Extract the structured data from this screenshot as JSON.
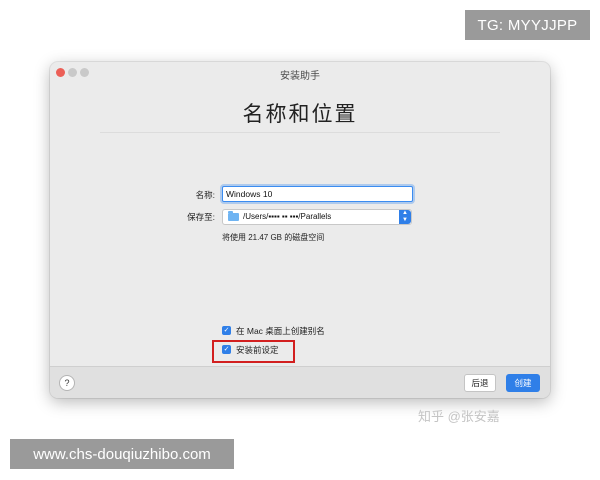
{
  "overlay": {
    "tg_badge": "TG: MYYJJPP",
    "site_banner": "www.chs-douqiuzhibo.com",
    "watermark": "知乎 @张安嘉"
  },
  "window": {
    "title": "安装助手",
    "heading": "名称和位置",
    "name_label": "名称:",
    "name_value": "Windows 10",
    "save_label": "保存至:",
    "save_path": "/Users/▪▪▪▪ ▪▪ ▪▪▪/Parallels",
    "disk_note": "将使用 21.47 GB 的磁盘空间",
    "checkbox_alias": "在 Mac 桌面上创建别名",
    "checkbox_alias_checked": true,
    "checkbox_preinstall": "安装前设定",
    "checkbox_preinstall_checked": true,
    "help_label": "?",
    "back_label": "后退",
    "create_label": "创建",
    "accent_color": "#2f7fe8",
    "highlight_color": "#d21f1f",
    "icons": [
      "folder-icon",
      "stepper-icon",
      "checkmark-icon",
      "help-icon"
    ]
  }
}
